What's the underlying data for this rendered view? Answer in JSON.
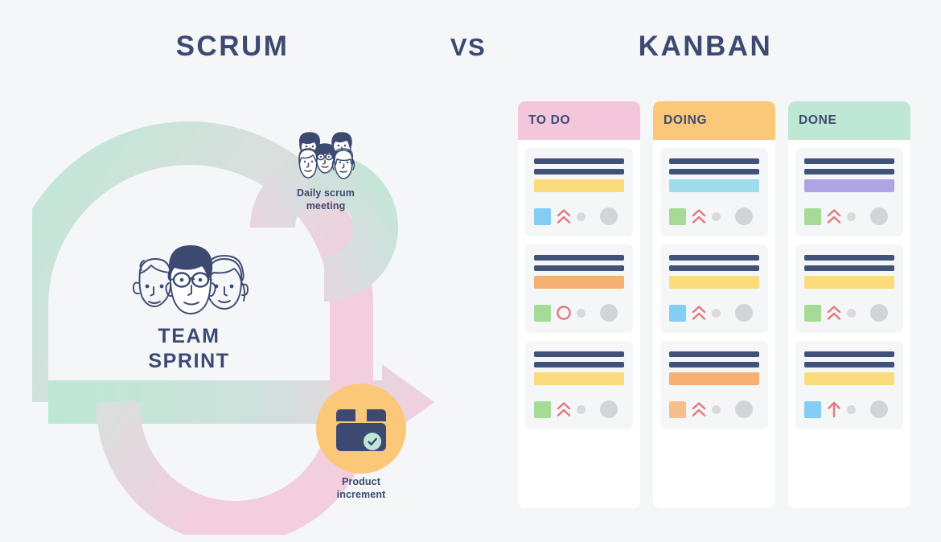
{
  "headings": {
    "left": "SCRUM",
    "middle": "VS",
    "right": "KANBAN"
  },
  "colors": {
    "background": "#F5F6F8",
    "navy": "#3C4A72",
    "bar_navy": "#41527A",
    "mint": "#BEE7D5",
    "pink": "#F2CEDE",
    "orange_circle": "#FBC87A",
    "header_todo": "#F4C6DC",
    "header_doing": "#FBC87A",
    "header_done": "#BEE7D5",
    "card_bg": "#F5F6F8",
    "column_bg": "#FFFFFF",
    "chevron_red": "#E4767C",
    "dot_gray": "#D5D6D8"
  },
  "scrum": {
    "team_label": "TEAM\nSPRINT",
    "team_label_line1": "TEAM",
    "team_label_line2": "SPRINT",
    "daily_label_line1": "Daily scrum",
    "daily_label_line2": "meeting",
    "product_label_line1": "Product",
    "product_label_line2": "increment",
    "team_faces_count": 3,
    "daily_faces_count": 5,
    "product_icon": "box-with-check"
  },
  "kanban": {
    "columns": [
      {
        "title": "TO DO",
        "header_color": "#F4C6DC",
        "cards": [
          {
            "title_bars": 2,
            "accent_color": "#FBDC7C",
            "swatch_color": "#84CDF5",
            "priority_icon": "double-chevron-up",
            "priority_color": "#E4767C",
            "has_small_dot": true,
            "has_large_dot": true
          },
          {
            "title_bars": 2,
            "accent_color": "#F5B173",
            "swatch_color": "#A5DB96",
            "priority_icon": "circle-outline",
            "priority_color": "#E4767C",
            "has_small_dot": true,
            "has_large_dot": true
          },
          {
            "title_bars": 2,
            "accent_color": "#FBDC7C",
            "swatch_color": "#A5DB96",
            "priority_icon": "double-chevron-up",
            "priority_color": "#E4767C",
            "has_small_dot": true,
            "has_large_dot": true
          }
        ]
      },
      {
        "title": "DOING",
        "header_color": "#FBC87A",
        "cards": [
          {
            "title_bars": 2,
            "accent_color": "#9EDCEA",
            "swatch_color": "#A5DB96",
            "priority_icon": "double-chevron-up",
            "priority_color": "#E4767C",
            "has_small_dot": true,
            "has_large_dot": true
          },
          {
            "title_bars": 2,
            "accent_color": "#FBDC7C",
            "swatch_color": "#84CDF5",
            "priority_icon": "double-chevron-up",
            "priority_color": "#E4767C",
            "has_small_dot": true,
            "has_large_dot": true
          },
          {
            "title_bars": 2,
            "accent_color": "#F5B173",
            "swatch_color": "#F5C08A",
            "priority_icon": "double-chevron-up",
            "priority_color": "#E4767C",
            "has_small_dot": true,
            "has_large_dot": true
          }
        ]
      },
      {
        "title": "DONE",
        "header_color": "#BEE7D5",
        "cards": [
          {
            "title_bars": 2,
            "accent_color": "#AFA3E3",
            "swatch_color": "#A5DB96",
            "priority_icon": "double-chevron-up",
            "priority_color": "#E4767C",
            "has_small_dot": true,
            "has_large_dot": true
          },
          {
            "title_bars": 2,
            "accent_color": "#FBDC7C",
            "swatch_color": "#A5DB96",
            "priority_icon": "double-chevron-up",
            "priority_color": "#E4767C",
            "has_small_dot": true,
            "has_large_dot": true
          },
          {
            "title_bars": 2,
            "accent_color": "#FBDC7C",
            "swatch_color": "#84CDF5",
            "priority_icon": "single-arrow-up",
            "priority_color": "#E4767C",
            "has_small_dot": true,
            "has_large_dot": true
          }
        ]
      }
    ]
  }
}
